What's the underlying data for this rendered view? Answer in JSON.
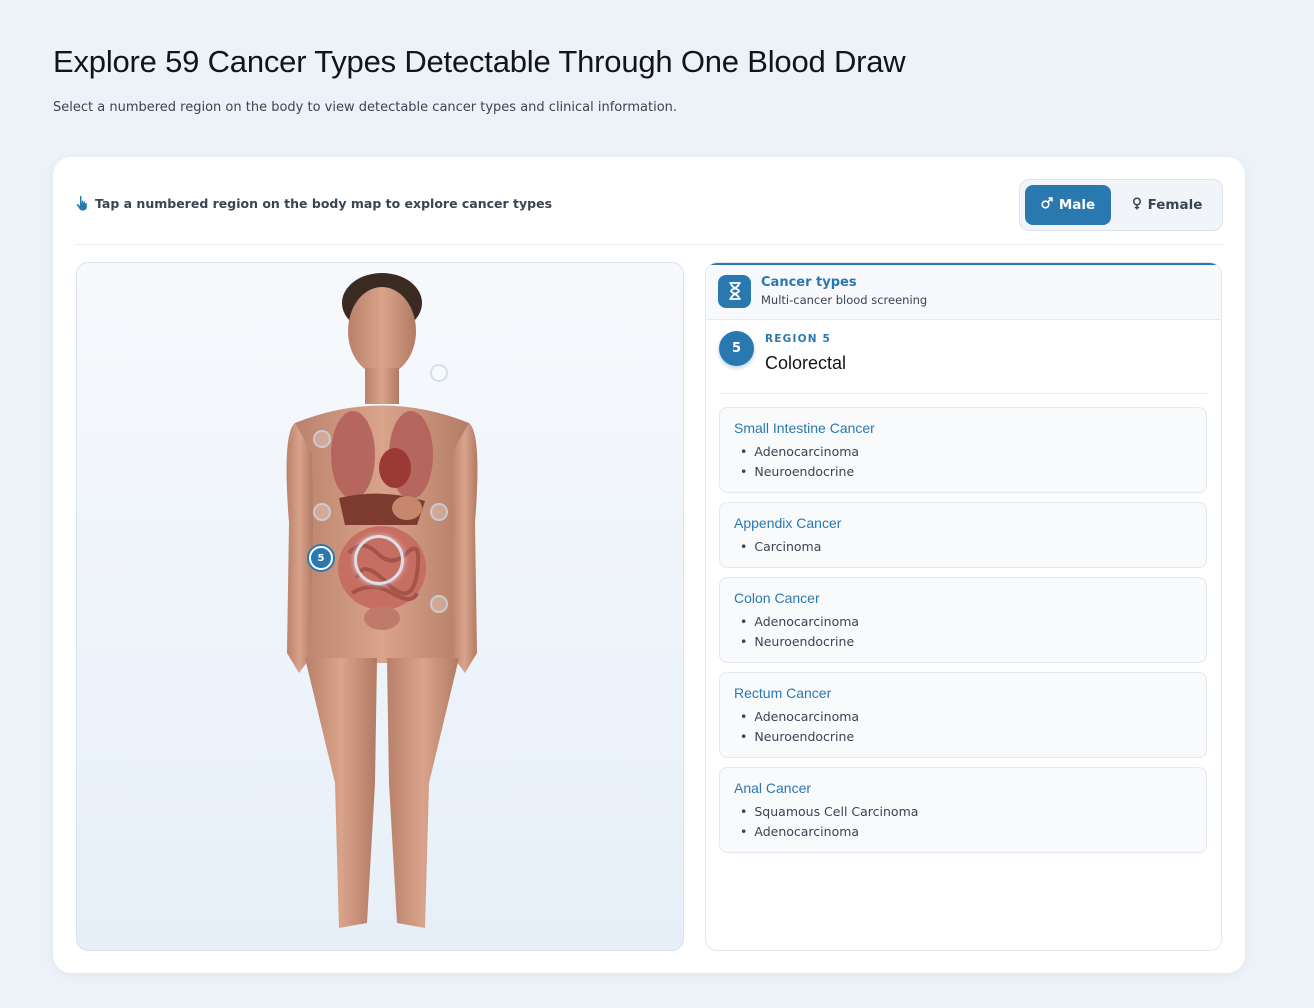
{
  "header": {
    "title": "Explore 59 Cancer Types Detectable Through One Blood Draw",
    "subtitle": "Select a numbered region on the body to view detectable cancer types and clinical information."
  },
  "toolbar": {
    "hint": "Tap a numbered region on the body map to explore cancer types",
    "hint_icon": "pointer-hand-icon",
    "sex_toggle": {
      "selected": "Male",
      "male_label": "Male",
      "female_label": "Female",
      "male_icon": "male-symbol-icon",
      "female_icon": "female-symbol-icon"
    }
  },
  "body_map": {
    "active_marker": "5"
  },
  "panel": {
    "icon": "dna-icon",
    "title": "Cancer types",
    "subtitle": "Multi-cancer blood screening",
    "region_number": "5",
    "region_label": "REGION 5",
    "region_name": "Colorectal",
    "cancers": [
      {
        "name": "Small Intestine Cancer",
        "subtypes": [
          "Adenocarcinoma",
          "Neuroendocrine"
        ]
      },
      {
        "name": "Appendix Cancer",
        "subtypes": [
          "Carcinoma"
        ]
      },
      {
        "name": "Colon Cancer",
        "subtypes": [
          "Adenocarcinoma",
          "Neuroendocrine"
        ]
      },
      {
        "name": "Rectum Cancer",
        "subtypes": [
          "Adenocarcinoma",
          "Neuroendocrine"
        ]
      },
      {
        "name": "Anal Cancer",
        "subtypes": [
          "Squamous Cell Carcinoma",
          "Adenocarcinoma"
        ]
      }
    ]
  },
  "colors": {
    "accent": "#2979b0",
    "background": "#edf2f8"
  }
}
